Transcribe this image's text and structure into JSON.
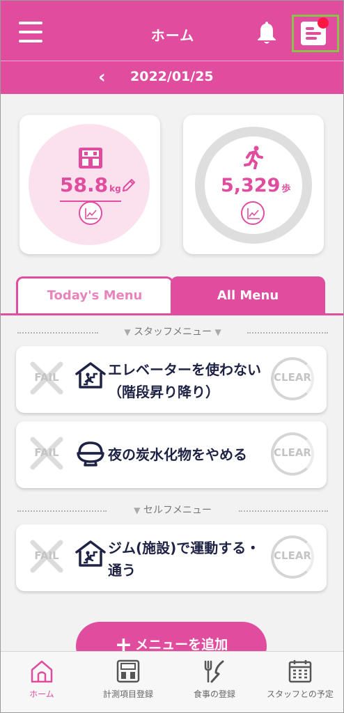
{
  "header": {
    "title": "ホーム",
    "menu_icon": "hamburger-icon",
    "bell_icon": "bell-icon",
    "notice_icon": "notice-document-icon"
  },
  "datebar": {
    "back": "‹",
    "date": "2022/01/25"
  },
  "weight": {
    "value": "58.8",
    "unit": "kg"
  },
  "steps": {
    "value": "5,329",
    "unit": "歩"
  },
  "tabs": {
    "today": "Today's Menu",
    "all": "All Menu"
  },
  "sections": {
    "staff": "スタッフメニュー",
    "self": "セルフメニュー"
  },
  "menus": [
    {
      "text": "エレベーターを使わない（階段昇り降り）",
      "icon": "house-stairs-icon",
      "fail": "FAIL",
      "clear": "CLEAR"
    },
    {
      "text": "夜の炭水化物をやめる",
      "icon": "rice-bowl-icon",
      "fail": "FAIL",
      "clear": "CLEAR"
    },
    {
      "text": "ジム(施設)で運動する・通う",
      "icon": "house-stairs-icon",
      "fail": "FAIL",
      "clear": "CLEAR"
    }
  ],
  "add_button": {
    "label": "メニューを追加"
  },
  "bottomnav": [
    {
      "label": "ホーム",
      "icon": "home-icon"
    },
    {
      "label": "計測項目登録",
      "icon": "scale-icon"
    },
    {
      "label": "食事の登録",
      "icon": "fork-knife-icon"
    },
    {
      "label": "スタッフとの予定",
      "icon": "calendar-icon"
    }
  ],
  "colors": {
    "accent": "#e04c9e",
    "accent_light": "#fbe0ee",
    "notice_dot": "#ff1744",
    "highlight": "#8bc34a"
  }
}
